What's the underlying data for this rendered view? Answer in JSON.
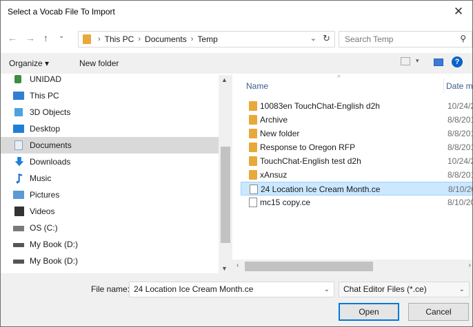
{
  "window": {
    "title": "Select a Vocab File To Import"
  },
  "nav": {
    "back": "←",
    "forward": "→",
    "up": "↑",
    "breadcrumbs": [
      "This PC",
      "Documents",
      "Temp"
    ],
    "search_placeholder": "Search Temp"
  },
  "toolbar": {
    "organize": "Organize ▾",
    "new_folder": "New folder"
  },
  "tree": [
    {
      "label": "UNIDAD",
      "icon": "drive-icon",
      "selected": false
    },
    {
      "label": "This PC",
      "icon": "pc-icon",
      "selected": false
    },
    {
      "label": "3D Objects",
      "icon": "cube-icon",
      "selected": false
    },
    {
      "label": "Desktop",
      "icon": "desktop-icon",
      "selected": false
    },
    {
      "label": "Documents",
      "icon": "documents-icon",
      "selected": true
    },
    {
      "label": "Downloads",
      "icon": "download-icon",
      "selected": false
    },
    {
      "label": "Music",
      "icon": "music-icon",
      "selected": false
    },
    {
      "label": "Pictures",
      "icon": "pictures-icon",
      "selected": false
    },
    {
      "label": "Videos",
      "icon": "videos-icon",
      "selected": false
    },
    {
      "label": "OS (C:)",
      "icon": "disk-icon",
      "selected": false
    },
    {
      "label": "My Book (D:)",
      "icon": "external-disk-icon",
      "selected": false
    },
    {
      "label": "My Book (D:)",
      "icon": "external-disk-icon",
      "selected": false
    }
  ],
  "columns": {
    "name": "Name",
    "date": "Date m"
  },
  "files": [
    {
      "name": "10083en TouchChat-English d2h",
      "date": "10/24/2",
      "type": "folder",
      "selected": false
    },
    {
      "name": "Archive",
      "date": "8/8/201",
      "type": "folder",
      "selected": false
    },
    {
      "name": "New folder",
      "date": "8/8/201",
      "type": "folder",
      "selected": false
    },
    {
      "name": "Response to Oregon RFP",
      "date": "8/8/201",
      "type": "folder",
      "selected": false
    },
    {
      "name": "TouchChat-English test d2h",
      "date": "10/24/2",
      "type": "folder",
      "selected": false
    },
    {
      "name": "xAnsuz",
      "date": "8/8/201",
      "type": "folder",
      "selected": false
    },
    {
      "name": "24 Location Ice Cream Month.ce",
      "date": "8/10/20",
      "type": "file",
      "selected": true
    },
    {
      "name": "mc15 copy.ce",
      "date": "8/10/20",
      "type": "file",
      "selected": false
    }
  ],
  "bottom": {
    "file_name_label": "File name:",
    "file_name_value": "24 Location Ice Cream Month.ce",
    "file_type": "Chat Editor Files (*.ce)",
    "open": "Open",
    "cancel": "Cancel"
  }
}
